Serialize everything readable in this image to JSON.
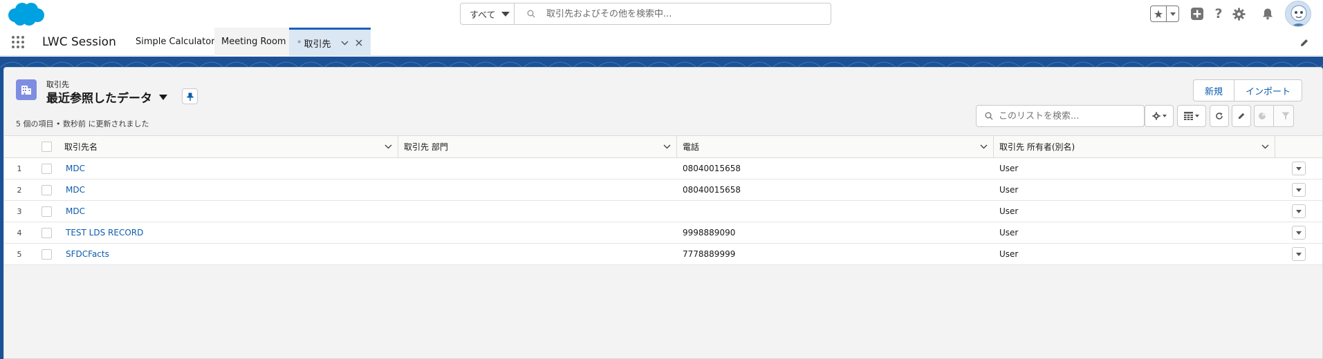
{
  "colors": {
    "brand_blue": "#1b5297",
    "link": "#0b5cab",
    "object_icon": "#7f8de1",
    "active_tab": "#dbe7f3"
  },
  "global_header": {
    "search_scope": "すべて",
    "search_placeholder": "取引先およびその他を検索中...",
    "icons": [
      "salesforce-cloud-logo",
      "favorites-star-icon",
      "add-icon",
      "help-icon",
      "setup-gear-icon",
      "notification-bell-icon",
      "user-avatar"
    ]
  },
  "app_nav": {
    "app_name": "LWC Session",
    "tabs": [
      {
        "label": "Simple Calculator",
        "active": false
      },
      {
        "label": "Meeting Room",
        "active": false
      },
      {
        "label": "取引先",
        "active": true,
        "dirty_marker": "*"
      }
    ]
  },
  "list_view": {
    "object_label": "取引先",
    "title": "最近参照したデータ",
    "meta": "5 個の項目 • 数秒前 に更新されました",
    "buttons": {
      "new": "新規",
      "import": "インポート"
    },
    "search_placeholder": "このリストを検索...",
    "columns": [
      "取引先名",
      "取引先 部門",
      "電話",
      "取引先 所有者(別名)"
    ],
    "rows": [
      {
        "num": "1",
        "name": "MDC",
        "dept": "",
        "phone": "08040015658",
        "owner": "User"
      },
      {
        "num": "2",
        "name": "MDC",
        "dept": "",
        "phone": "08040015658",
        "owner": "User"
      },
      {
        "num": "3",
        "name": "MDC",
        "dept": "",
        "phone": "",
        "owner": "User"
      },
      {
        "num": "4",
        "name": "TEST LDS RECORD",
        "dept": "",
        "phone": "9998889090",
        "owner": "User"
      },
      {
        "num": "5",
        "name": "SFDCFacts",
        "dept": "",
        "phone": "7778889999",
        "owner": "User"
      }
    ]
  }
}
